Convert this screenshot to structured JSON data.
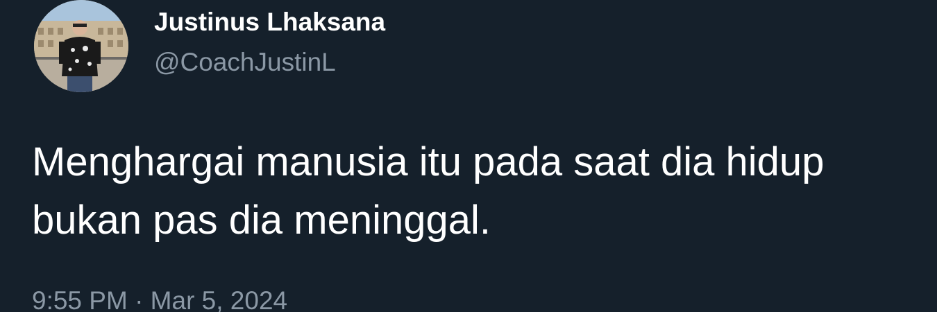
{
  "author": {
    "display_name": "Justinus Lhaksana",
    "handle": "@CoachJustinL",
    "avatar_icon": "profile-photo"
  },
  "tweet": {
    "text": "Menghargai manusia itu pada saat dia hidup bukan pas dia meninggal.",
    "timestamp": "9:55 PM · Mar 5, 2024"
  },
  "colors": {
    "background": "#15202b",
    "primary_text": "#ffffff",
    "secondary_text": "#8b98a5"
  }
}
